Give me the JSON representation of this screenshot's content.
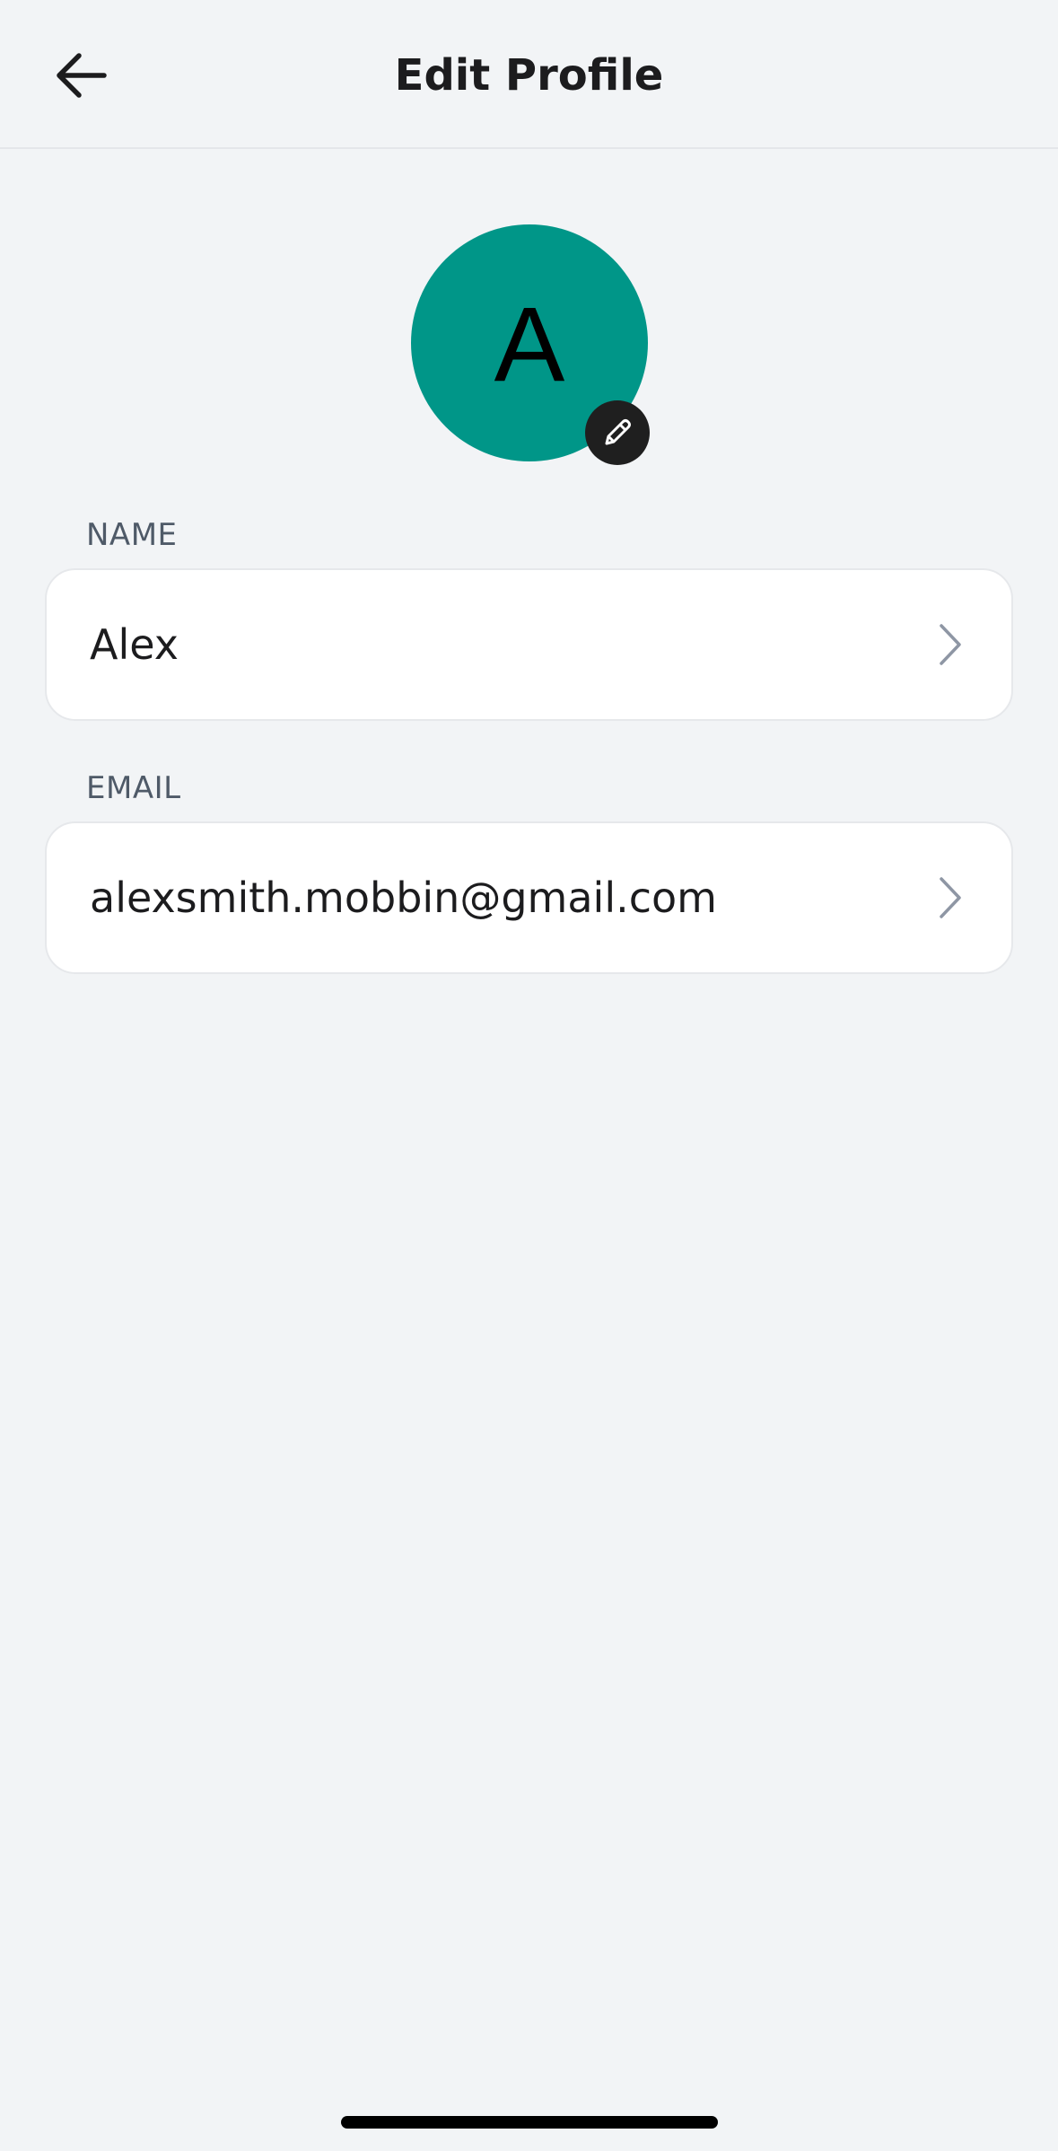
{
  "header": {
    "title": "Edit Profile",
    "back_icon": "arrow-left-icon"
  },
  "avatar": {
    "initial": "A",
    "color": "#009688",
    "edit_icon": "pencil-icon"
  },
  "fields": {
    "name": {
      "label": "NAME",
      "value": "Alex",
      "icon": "chevron-right-icon"
    },
    "email": {
      "label": "EMAIL",
      "value": "alexsmith.mobbin@gmail.com",
      "icon": "chevron-right-icon"
    }
  },
  "colors": {
    "background": "#f2f4f6",
    "card": "#ffffff",
    "label": "#4f5a68",
    "chevron": "#8e96a4"
  }
}
